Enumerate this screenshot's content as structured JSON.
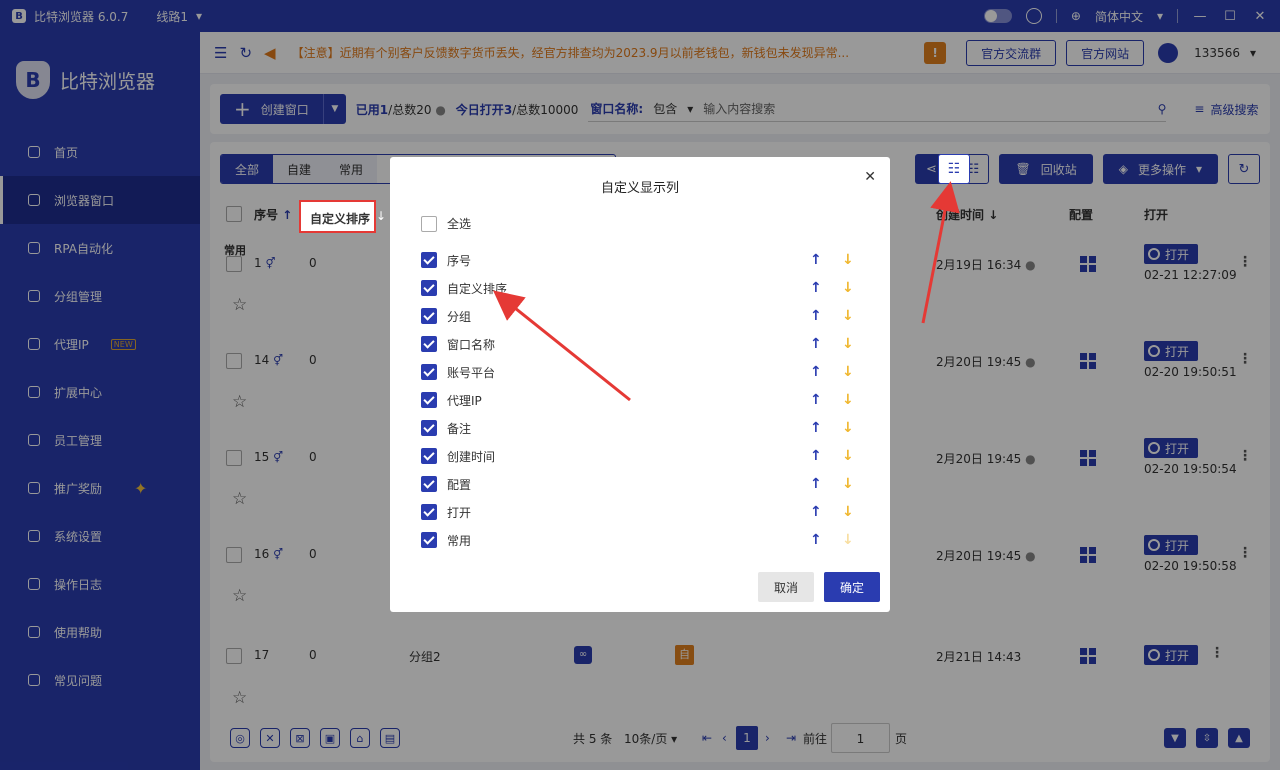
{
  "titlebar": {
    "app_title": "比特浏览器 6.0.7",
    "line": "线路1",
    "language": "简体中文"
  },
  "sidebar": {
    "brand": "比特浏览器",
    "items": [
      {
        "label": "首页",
        "icon": "home-icon"
      },
      {
        "label": "浏览器窗口",
        "icon": "grid-icon",
        "active": true
      },
      {
        "label": "RPA自动化",
        "icon": "robot-icon"
      },
      {
        "label": "分组管理",
        "icon": "layers-icon"
      },
      {
        "label": "代理IP",
        "icon": "location-icon",
        "badge": "NEW"
      },
      {
        "label": "扩展中心",
        "icon": "cube-icon"
      },
      {
        "label": "员工管理",
        "icon": "users-icon"
      },
      {
        "label": "推广奖励",
        "icon": "gift-icon"
      },
      {
        "label": "系统设置",
        "icon": "gear-icon"
      },
      {
        "label": "操作日志",
        "icon": "log-icon"
      },
      {
        "label": "使用帮助",
        "icon": "help-icon"
      },
      {
        "label": "常见问题",
        "icon": "info-icon"
      }
    ]
  },
  "notice": {
    "text": "【注意】近期有个别客户反馈数字货币丢失，经官方排查均为2023.9月以前老钱包，新钱包未发现异常...",
    "badge": "!",
    "btn_group": "官方交流群",
    "btn_site": "官方网站",
    "user_id": "133566"
  },
  "toolbar": {
    "create": "创建窗口",
    "used_label": "已用",
    "used": "1",
    "total": "/总数20",
    "today_label": "今日打开",
    "today": "3",
    "today_total": "/总数10000",
    "search_label": "窗口名称:",
    "search_mode": "包含",
    "search_placeholder": "输入内容搜索",
    "advanced": "高级搜索"
  },
  "tabs": [
    "全部",
    "自建",
    "常用"
  ],
  "actions": {
    "recycle": "回收站",
    "more": "更多操作"
  },
  "table": {
    "headers": {
      "seq": "序号",
      "custom_sort": "自定义排序",
      "created": "创建时间",
      "config": "配置",
      "open": "打开"
    },
    "group_label": "常用",
    "open_label": "打开",
    "rows": [
      {
        "seq": "1",
        "sort": "0",
        "group": "",
        "created": "2月19日 16:34",
        "opened": "02-21 12:27:09"
      },
      {
        "seq": "14",
        "sort": "0",
        "group": "",
        "created": "2月20日 19:45",
        "opened": "02-20 19:50:51"
      },
      {
        "seq": "15",
        "sort": "0",
        "group": "",
        "created": "2月20日 19:45",
        "opened": "02-20 19:50:54"
      },
      {
        "seq": "16",
        "sort": "0",
        "group": "",
        "created": "2月20日 19:45",
        "opened": "02-20 19:50:58"
      },
      {
        "seq": "17",
        "sort": "0",
        "group": "分组2",
        "created": "2月21日 14:43",
        "opened": "",
        "tag": "自"
      }
    ]
  },
  "pager": {
    "total": "共 5 条",
    "per_page": "10条/页",
    "page": "1",
    "goto_label": "前往",
    "goto_value": "1",
    "page_unit": "页"
  },
  "modal": {
    "title": "自定义显示列",
    "select_all": "全选",
    "columns": [
      "序号",
      "自定义排序",
      "分组",
      "窗口名称",
      "账号平台",
      "代理IP",
      "备注",
      "创建时间",
      "配置",
      "打开",
      "常用"
    ],
    "cancel": "取消",
    "confirm": "确定"
  },
  "colors": {
    "primary": "#2a3cb0",
    "warning": "#e27b1b",
    "annotation": "#e53935"
  }
}
